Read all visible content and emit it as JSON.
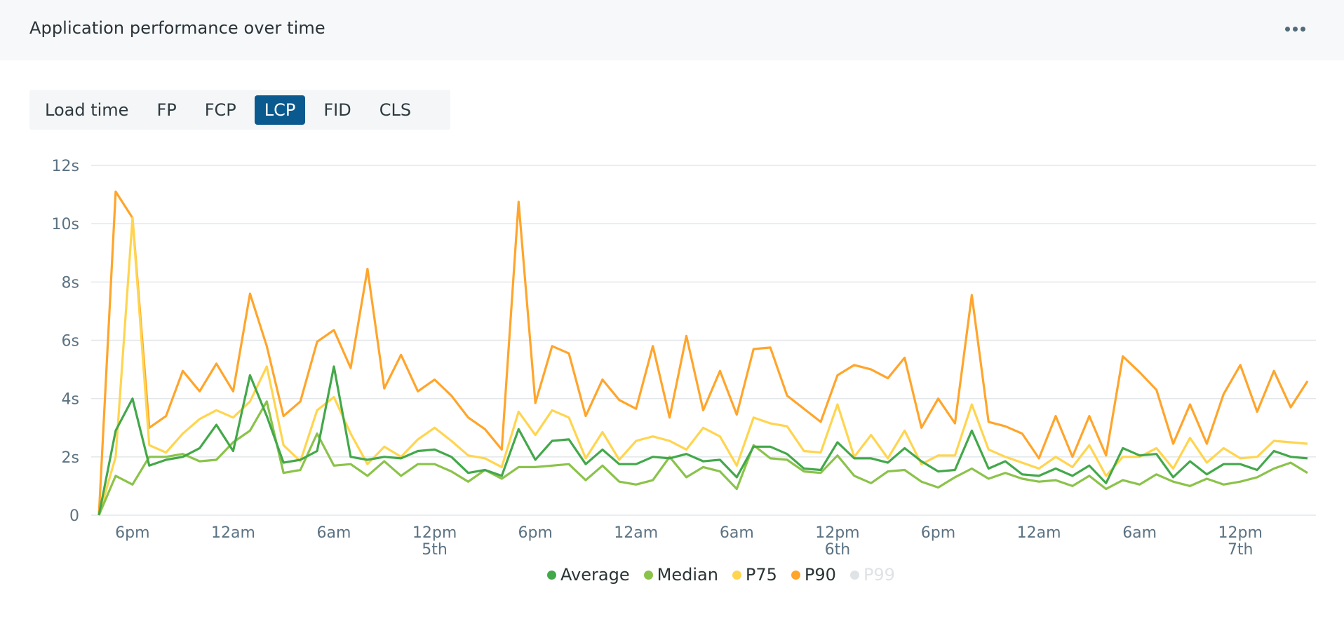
{
  "header": {
    "title": "Application performance over time",
    "more_icon": "more-horizontal-icon"
  },
  "tabs": [
    {
      "label": "Load time",
      "active": false
    },
    {
      "label": "FP",
      "active": false
    },
    {
      "label": "FCP",
      "active": false
    },
    {
      "label": "LCP",
      "active": true
    },
    {
      "label": "FID",
      "active": false
    },
    {
      "label": "CLS",
      "active": false
    }
  ],
  "chart_data": {
    "type": "line",
    "title": "",
    "xlabel": "",
    "ylabel": "",
    "ylim": [
      0,
      12
    ],
    "y_ticks": [
      {
        "value": 0,
        "label": "0"
      },
      {
        "value": 2,
        "label": "2s"
      },
      {
        "value": 4,
        "label": "4s"
      },
      {
        "value": 6,
        "label": "6s"
      },
      {
        "value": 8,
        "label": "8s"
      },
      {
        "value": 10,
        "label": "10s"
      },
      {
        "value": 12,
        "label": "12s"
      }
    ],
    "x_unit": "hour index (0 = 4pm 4th, 72 = 4pm 7th)",
    "x_ticks": [
      {
        "index": 2,
        "label": "6pm",
        "sub": ""
      },
      {
        "index": 8,
        "label": "12am",
        "sub": ""
      },
      {
        "index": 14,
        "label": "6am",
        "sub": ""
      },
      {
        "index": 20,
        "label": "12pm",
        "sub": "5th"
      },
      {
        "index": 26,
        "label": "6pm",
        "sub": ""
      },
      {
        "index": 32,
        "label": "12am",
        "sub": ""
      },
      {
        "index": 38,
        "label": "6am",
        "sub": ""
      },
      {
        "index": 44,
        "label": "12pm",
        "sub": "6th"
      },
      {
        "index": 50,
        "label": "6pm",
        "sub": ""
      },
      {
        "index": 56,
        "label": "12am",
        "sub": ""
      },
      {
        "index": 62,
        "label": "6am",
        "sub": ""
      },
      {
        "index": 68,
        "label": "12pm",
        "sub": "7th"
      }
    ],
    "grid": true,
    "legend_position": "bottom-center",
    "series": [
      {
        "name": "Average",
        "color": "#43a84a",
        "visible": true,
        "values": [
          0.0,
          2.9,
          4.0,
          1.7,
          1.9,
          2.0,
          2.3,
          3.1,
          2.2,
          4.8,
          3.4,
          1.8,
          1.9,
          2.2,
          5.1,
          2.0,
          1.9,
          2.0,
          1.95,
          2.2,
          2.25,
          2.0,
          1.45,
          1.55,
          1.35,
          2.95,
          1.9,
          2.55,
          2.6,
          1.75,
          2.25,
          1.75,
          1.75,
          2.0,
          1.95,
          2.1,
          1.85,
          1.9,
          1.3,
          2.35,
          2.35,
          2.1,
          1.6,
          1.55,
          2.5,
          1.95,
          1.95,
          1.8,
          2.3,
          1.85,
          1.5,
          1.55,
          2.9,
          1.6,
          1.85,
          1.4,
          1.35,
          1.6,
          1.35,
          1.7,
          1.1,
          2.3,
          2.05,
          2.1,
          1.3,
          1.85,
          1.4,
          1.75,
          1.75,
          1.55,
          2.2,
          2.0,
          1.95
        ]
      },
      {
        "name": "Median",
        "color": "#8bc34a",
        "visible": true,
        "values": [
          0.0,
          1.35,
          1.05,
          2.0,
          2.0,
          2.1,
          1.85,
          1.9,
          2.5,
          2.9,
          3.9,
          1.45,
          1.55,
          2.8,
          1.7,
          1.75,
          1.35,
          1.85,
          1.35,
          1.75,
          1.75,
          1.5,
          1.15,
          1.55,
          1.25,
          1.65,
          1.65,
          1.7,
          1.75,
          1.2,
          1.7,
          1.15,
          1.05,
          1.2,
          2.0,
          1.3,
          1.65,
          1.5,
          0.9,
          2.4,
          1.95,
          1.9,
          1.5,
          1.45,
          2.05,
          1.35,
          1.1,
          1.5,
          1.55,
          1.15,
          0.95,
          1.3,
          1.6,
          1.25,
          1.45,
          1.25,
          1.15,
          1.2,
          1.0,
          1.35,
          0.9,
          1.2,
          1.05,
          1.4,
          1.15,
          1.0,
          1.25,
          1.05,
          1.15,
          1.3,
          1.6,
          1.8,
          1.45
        ]
      },
      {
        "name": "P75",
        "color": "#ffd54f",
        "visible": true,
        "values": [
          0.0,
          2.0,
          10.2,
          2.4,
          2.15,
          2.8,
          3.3,
          3.6,
          3.35,
          3.9,
          5.1,
          2.4,
          1.85,
          3.6,
          4.05,
          2.8,
          1.75,
          2.35,
          2.0,
          2.6,
          3.0,
          2.55,
          2.05,
          1.95,
          1.65,
          3.55,
          2.75,
          3.6,
          3.35,
          1.95,
          2.85,
          1.9,
          2.55,
          2.7,
          2.55,
          2.25,
          3.0,
          2.7,
          1.7,
          3.35,
          3.15,
          3.05,
          2.2,
          2.15,
          3.8,
          2.0,
          2.75,
          1.95,
          2.9,
          1.75,
          2.05,
          2.05,
          3.8,
          2.25,
          2.0,
          1.8,
          1.6,
          2.0,
          1.65,
          2.4,
          1.35,
          2.0,
          2.0,
          2.3,
          1.6,
          2.65,
          1.8,
          2.3,
          1.95,
          2.0,
          2.55,
          2.5,
          2.45
        ]
      },
      {
        "name": "P90",
        "color": "#ffa52b",
        "visible": true,
        "values": [
          0.0,
          11.1,
          10.2,
          3.0,
          3.4,
          4.95,
          4.25,
          5.2,
          4.25,
          7.6,
          5.8,
          3.4,
          3.9,
          5.95,
          6.35,
          5.05,
          8.45,
          4.35,
          5.5,
          4.25,
          4.65,
          4.1,
          3.35,
          2.95,
          2.25,
          10.75,
          3.85,
          5.8,
          5.55,
          3.4,
          4.65,
          3.95,
          3.65,
          5.8,
          3.35,
          6.15,
          3.6,
          4.95,
          3.45,
          5.7,
          5.75,
          4.1,
          3.65,
          3.2,
          4.8,
          5.15,
          5.0,
          4.7,
          5.4,
          3.0,
          4.0,
          3.15,
          7.55,
          3.2,
          3.05,
          2.8,
          1.95,
          3.4,
          2.0,
          3.4,
          2.05,
          5.45,
          4.9,
          4.3,
          2.45,
          3.8,
          2.45,
          4.15,
          5.15,
          3.55,
          4.95,
          3.7,
          4.6
        ]
      },
      {
        "name": "P99",
        "color": "#dfe3e6",
        "visible": false,
        "values": []
      }
    ]
  },
  "legend": [
    {
      "label": "Average",
      "color": "#43a84a",
      "disabled": false
    },
    {
      "label": "Median",
      "color": "#8bc34a",
      "disabled": false
    },
    {
      "label": "P75",
      "color": "#ffd54f",
      "disabled": false
    },
    {
      "label": "P90",
      "color": "#ffa52b",
      "disabled": false
    },
    {
      "label": "P99",
      "color": "#dfe3e6",
      "disabled": true
    }
  ]
}
